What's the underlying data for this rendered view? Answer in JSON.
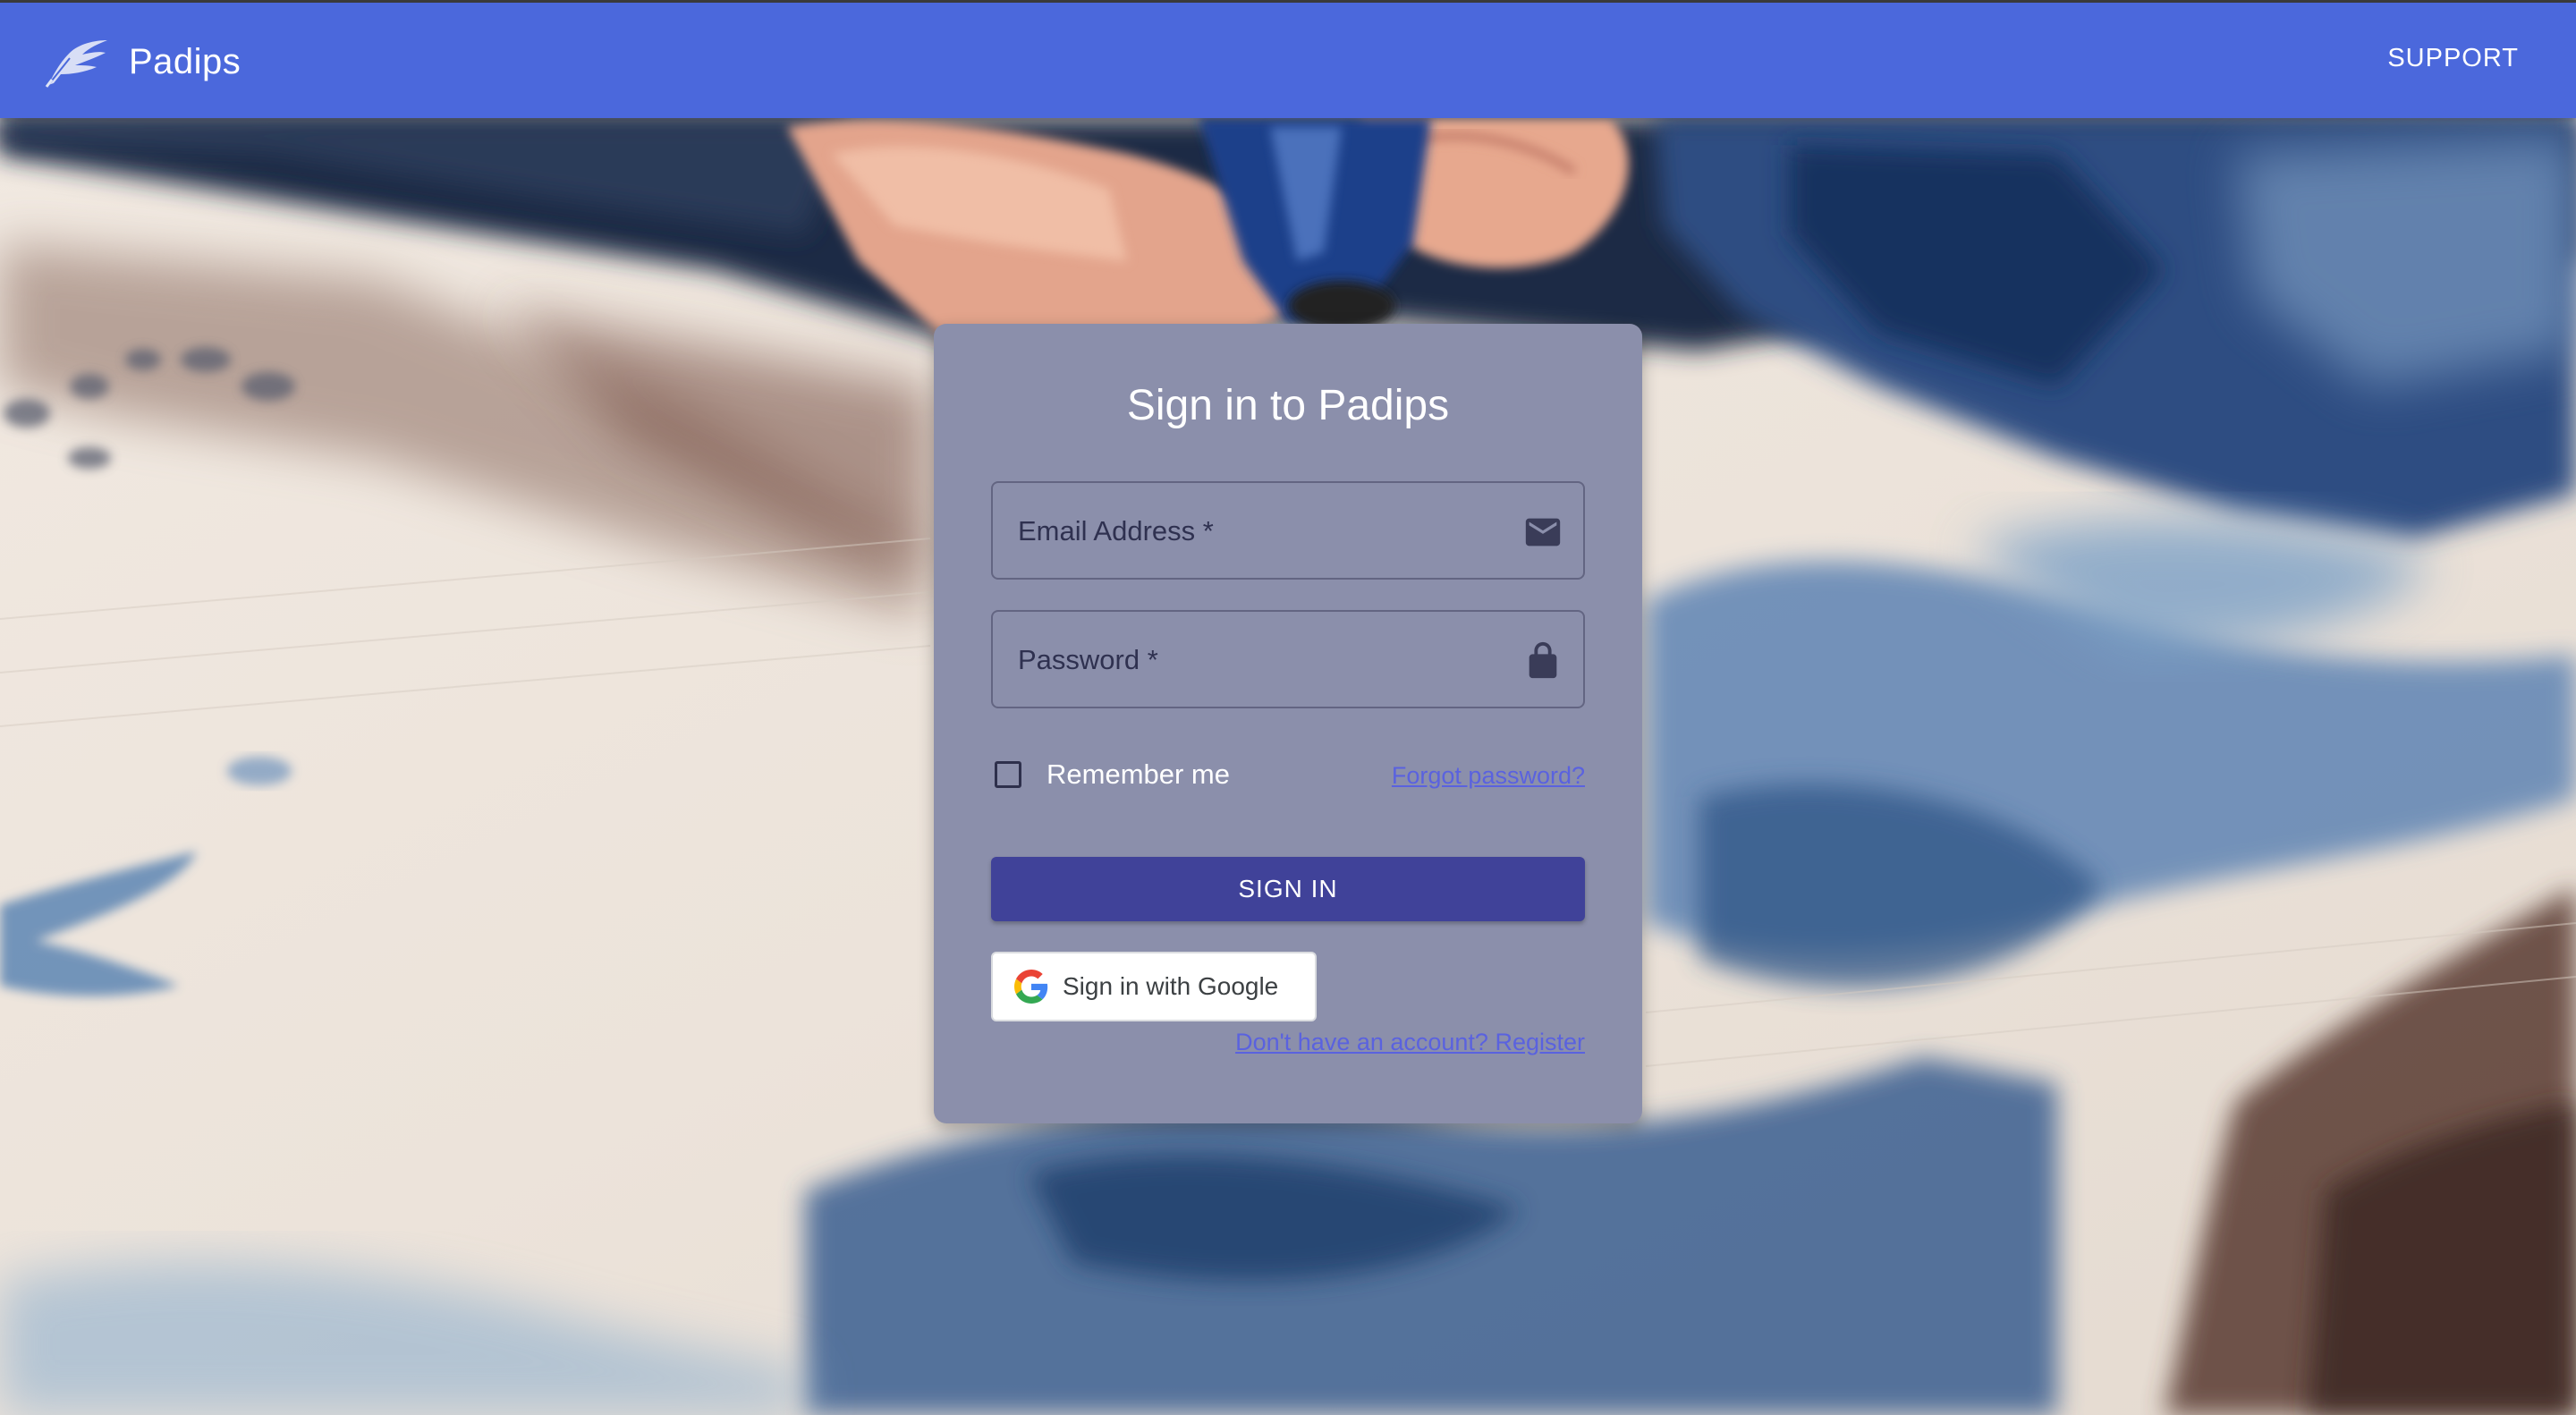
{
  "appbar": {
    "brand_name": "Padips",
    "support_label": "SUPPORT",
    "logo_icon": "feather-quill-icon",
    "background_color": "#4b68dc"
  },
  "signin": {
    "title": "Sign in to Padips",
    "email_label": "Email Address *",
    "email_icon": "envelope-icon",
    "password_label": "Password *",
    "password_icon": "lock-icon",
    "remember_label": "Remember me",
    "remember_checked": false,
    "forgot_label": "Forgot password?",
    "signin_label": "SIGN IN",
    "google_label": "Sign in with Google",
    "google_icon": "google-g-icon",
    "register_label": "Don't have an account? Register",
    "card_color": "#8b8fab",
    "button_color": "#404299",
    "link_color": "#5a62df"
  },
  "background": {
    "description_icon": "watercolor-background-image"
  }
}
